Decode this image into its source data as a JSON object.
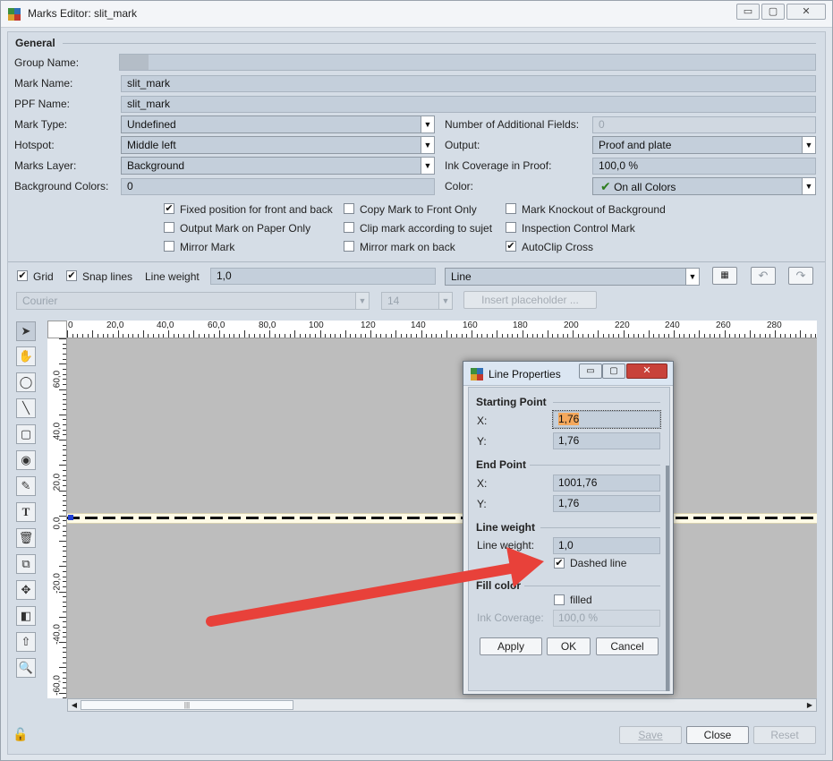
{
  "window": {
    "title": "Marks Editor: slit_mark",
    "minimize": "▭",
    "restore": "▢",
    "close": "✕"
  },
  "general": {
    "heading": "General",
    "group_name": {
      "label": "Group Name:",
      "value": ""
    },
    "mark_name": {
      "label": "Mark Name:",
      "value": "slit_mark"
    },
    "ppf_name": {
      "label": "PPF Name:",
      "value": "slit_mark"
    },
    "mark_type": {
      "label": "Mark Type:",
      "value": "Undefined"
    },
    "hotspot": {
      "label": "Hotspot:",
      "value": "Middle left"
    },
    "marks_layer": {
      "label": "Marks Layer:",
      "value": "Background"
    },
    "background_colors": {
      "label": "Background Colors:",
      "value": "0"
    },
    "additional_fields": {
      "label": "Number of Additional Fields:",
      "value": "0"
    },
    "output": {
      "label": "Output:",
      "value": "Proof and plate"
    },
    "ink_coverage": {
      "label": "Ink Coverage in Proof:",
      "value": "100,0 %"
    },
    "color": {
      "label": "Color:",
      "value": "On all Colors"
    }
  },
  "options": [
    {
      "label": "Fixed position for front and back",
      "checked": true
    },
    {
      "label": "Output Mark on Paper Only",
      "checked": false
    },
    {
      "label": "Mirror Mark",
      "checked": false
    },
    {
      "label": "Copy Mark to Front Only",
      "checked": false
    },
    {
      "label": "Clip mark according to sujet",
      "checked": false
    },
    {
      "label": "Mirror mark on back",
      "checked": false
    },
    {
      "label": "Mark Knockout of Background",
      "checked": false
    },
    {
      "label": "Inspection Control Mark",
      "checked": false
    },
    {
      "label": "AutoClip Cross",
      "checked": true
    }
  ],
  "toolbar": {
    "grid_label": "Grid",
    "snap_label": "Snap lines",
    "line_weight_label": "Line weight",
    "line_weight_value": "1,0",
    "shape_value": "Line",
    "font_value": "Courier",
    "font_size_value": "14",
    "insert_placeholder": "Insert placeholder ..."
  },
  "ruler": {
    "h_labels": [
      "0",
      "20,0",
      "40,0",
      "60,0",
      "80,0",
      "100",
      "120",
      "140",
      "160",
      "180",
      "200",
      "220",
      "240",
      "260",
      "280"
    ],
    "v_labels": [
      "60,0",
      "40,0",
      "20,0",
      "0,0",
      "-20,0",
      "-40,0",
      "-60,0"
    ]
  },
  "line_properties": {
    "title": "Line Properties",
    "starting_point": "Starting Point",
    "start_x": {
      "label": "X:",
      "value": "1,76"
    },
    "start_y": {
      "label": "Y:",
      "value": "1,76"
    },
    "end_point": "End Point",
    "end_x": {
      "label": "X:",
      "value": "1001,76"
    },
    "end_y": {
      "label": "Y:",
      "value": "1,76"
    },
    "line_weight_heading": "Line weight",
    "line_weight": {
      "label": "Line weight:",
      "value": "1,0"
    },
    "dashed_line": "Dashed line",
    "fill_heading": "Fill color",
    "filled": "filled",
    "ink_coverage": {
      "label": "Ink Coverage:",
      "value": "100,0 %"
    },
    "apply": "Apply",
    "ok": "OK",
    "cancel": "Cancel"
  },
  "footer": {
    "save": "Save",
    "close": "Close",
    "reset": "Reset"
  }
}
